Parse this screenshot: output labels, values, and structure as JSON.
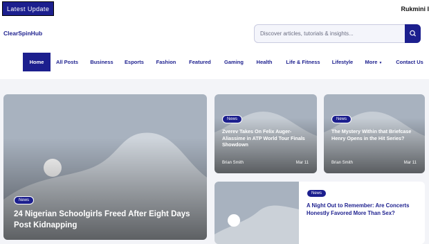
{
  "topbar": {
    "latest_label": "Latest Update",
    "ticker_text": "Rukmini I"
  },
  "header": {
    "brand": "ClearSpinHub",
    "search": {
      "placeholder": "Discover articles, tutorials & insights..."
    }
  },
  "nav": {
    "items": [
      {
        "label": "Home"
      },
      {
        "label": "All Posts"
      },
      {
        "label": "Business"
      },
      {
        "label": "Esports"
      },
      {
        "label": "Fashion"
      },
      {
        "label": "Featured"
      },
      {
        "label": "Gaming"
      },
      {
        "label": "Health"
      },
      {
        "label": "Life & Fitness"
      },
      {
        "label": "Lifestyle"
      },
      {
        "label": "More"
      },
      {
        "label": "Contact Us"
      }
    ]
  },
  "posts": {
    "hero": {
      "badge": "News",
      "title": "24 Nigerian Schoolgirls Freed After Eight Days Post Kidnapping"
    },
    "card1": {
      "badge": "News",
      "title": "Zverev Takes On Felix Auger-Aliassime in ATP World Tour Finals Showdown",
      "author": "Brian Smith",
      "date": "Mar 11"
    },
    "card2": {
      "badge": "News",
      "title": "The Mystery Within that Briefcase Henry Opens in the Hit Series?",
      "author": "Brian Smith",
      "date": "Mar 11"
    },
    "card3": {
      "badge": "News",
      "title": "A Night Out to Remember: Are Concerts Honestly Favored More Than Sex?"
    }
  },
  "colors": {
    "accent": "#1c1f8e",
    "placeholder_bg": "#a8b2bf"
  }
}
